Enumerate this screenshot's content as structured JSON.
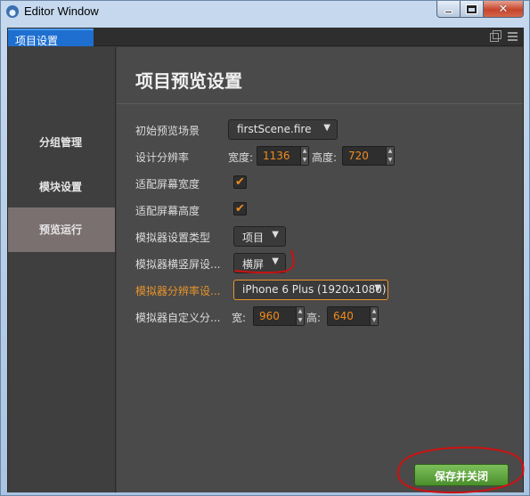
{
  "window": {
    "title": "Editor Window",
    "close_glyph": "✕"
  },
  "tab": {
    "label": "项目设置"
  },
  "sidebar": {
    "items": [
      {
        "label": "分组管理",
        "active": false
      },
      {
        "label": "模块设置",
        "active": false
      },
      {
        "label": "预览运行",
        "active": true
      }
    ]
  },
  "main": {
    "title": "项目预览设置",
    "rows": {
      "start_scene": {
        "label": "初始预览场景",
        "value": "firstScene.fire"
      },
      "design_res": {
        "label": "设计分辨率",
        "width_label": "宽度:",
        "width": "1136",
        "height_label": "高度:",
        "height": "720"
      },
      "fit_width": {
        "label": "适配屏幕宽度",
        "checked": true
      },
      "fit_height": {
        "label": "适配屏幕高度",
        "checked": true
      },
      "sim_type": {
        "label": "模拟器设置类型",
        "value": "项目"
      },
      "sim_orient": {
        "label": "模拟器横竖屏设...",
        "value": "横屏"
      },
      "sim_res": {
        "label": "模拟器分辨率设...",
        "value": "iPhone 6 Plus (1920x1080)"
      },
      "sim_custom": {
        "label": "模拟器自定义分...",
        "width_label": "宽:",
        "width": "960",
        "height_label": "高:",
        "height": "640"
      }
    },
    "save_label": "保存并关闭"
  },
  "icons": {
    "check": "✔",
    "dropdown_arrow": "▼",
    "spin_up": "▲",
    "spin_down": "▼"
  },
  "colors": {
    "accent": "#f08c1e",
    "tab": "#1f6fd1",
    "save": "#4a8f2c",
    "annotation": "#cc1111"
  }
}
